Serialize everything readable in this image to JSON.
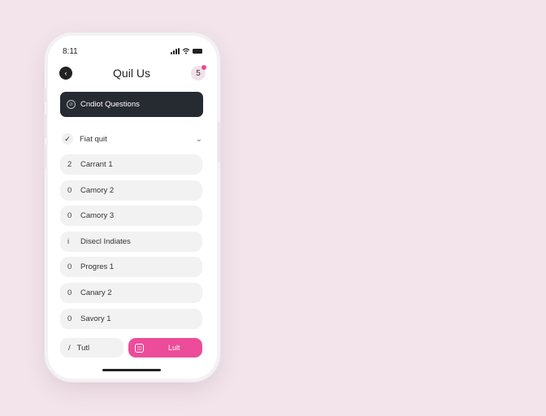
{
  "status_bar": {
    "time": "8:11"
  },
  "header": {
    "back_icon": "back-icon",
    "back_glyph": "‹",
    "title": "Quil Us",
    "avatar_text": "5"
  },
  "banner": {
    "icon_glyph": "⊘",
    "label": "Cndiot Questions"
  },
  "section": {
    "check_glyph": "✓",
    "label": "Fiat quit",
    "chevron_glyph": "⌄"
  },
  "list": {
    "items": [
      {
        "num": "2",
        "label": "Carrant 1"
      },
      {
        "num": "0",
        "label": "Camory 2"
      },
      {
        "num": "0",
        "label": "Camory 3"
      },
      {
        "num": "i",
        "label": "Disecl Indiates"
      },
      {
        "num": "0",
        "label": "Progres 1"
      },
      {
        "num": "0",
        "label": "Canary 2"
      },
      {
        "num": "0",
        "label": "Savory 1"
      }
    ]
  },
  "buttons": {
    "secondary_glyph": "/",
    "secondary_label": "Tutl",
    "primary_icon_glyph": "◫",
    "primary_label": "Lult"
  },
  "colors": {
    "background": "#f2e4ea",
    "dark_banner": "#262a31",
    "accent_pink": "#ec4c9a",
    "list_item": "#f3f2f3"
  }
}
